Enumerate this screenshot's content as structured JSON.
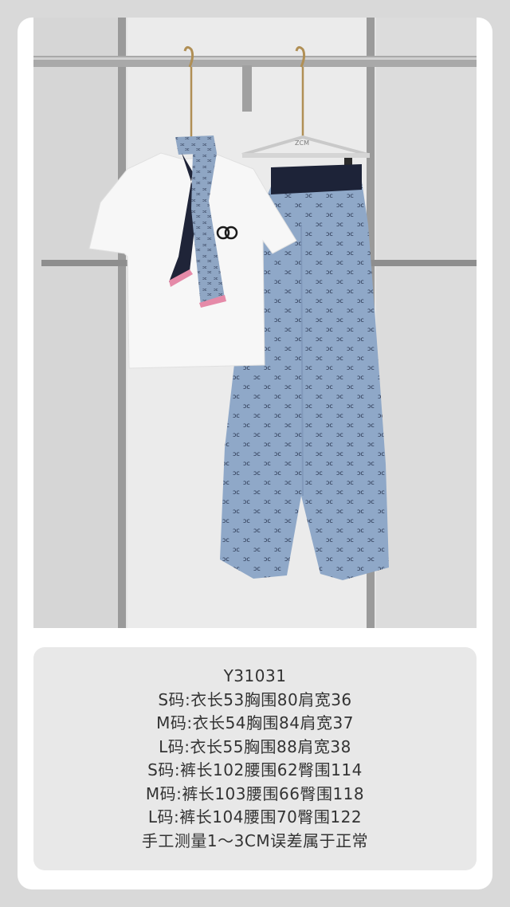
{
  "product": {
    "code": "Y31031",
    "size_lines": [
      "S码:衣长53胸围80肩宽36",
      "M码:衣长54胸围84肩宽37",
      "L码:衣长55胸围88肩宽38",
      "S码:裤长102腰围62臀围114",
      "M码:裤长103腰围66臀围118",
      "L码:裤长104腰围70臀围122"
    ],
    "note": "手工测量1～3CM误差属于正常"
  },
  "photo": {
    "hanger_label": "ZCM",
    "colors": {
      "background": "#e4e4e4",
      "tshirt": "#f7f7f7",
      "pants": "#8fa8c8",
      "waistband": "#1d2338",
      "scarf": "#8fa6c4",
      "scarf_trim": "#e58aa8",
      "rail": "#9a9a9a"
    }
  }
}
